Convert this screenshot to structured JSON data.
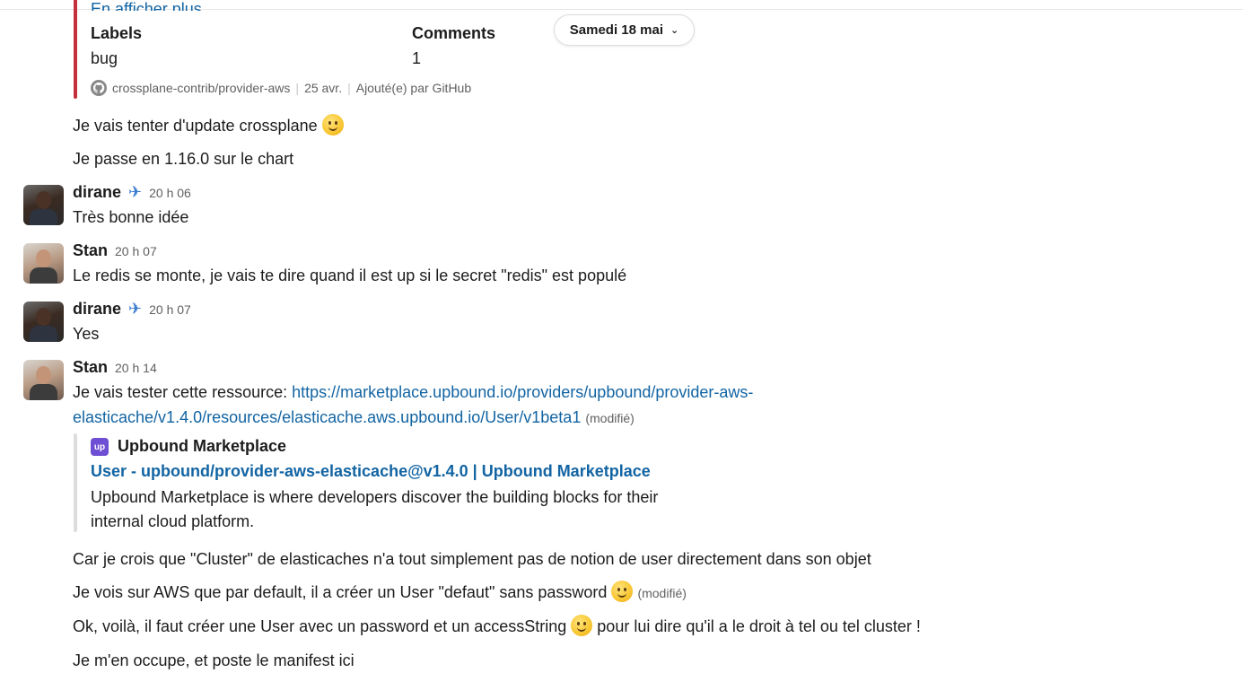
{
  "github_unfurl": {
    "more_link": "En afficher plus",
    "fields": [
      {
        "title": "Labels",
        "value": "bug"
      },
      {
        "title": "Comments",
        "value": "1"
      }
    ],
    "footer": {
      "repo": "crossplane-contrib/provider-aws",
      "date": "25 avr.",
      "added_by": "Ajouté(e) par GitHub"
    }
  },
  "date_divider": {
    "label": "Samedi 18 mai"
  },
  "pre_messages": [
    {
      "text": "Je vais tenter d'update crossplane"
    },
    {
      "text": "Je passe en 1.16.0 sur le chart"
    }
  ],
  "messages": [
    {
      "author": "dirane",
      "status_emoji": "✈️",
      "time": "20 h 06",
      "text": "Très bonne idée"
    },
    {
      "author": "Stan",
      "time": "20 h 07",
      "text": "Le redis se monte, je vais te dire quand il est up si le secret \"redis\" est populé"
    },
    {
      "author": "dirane",
      "status_emoji": "✈️",
      "time": "20 h 07",
      "text": "Yes"
    },
    {
      "author": "Stan",
      "time": "20 h 14",
      "text_prefix": "Je vais tester cette ressource: ",
      "link_line1": "https://marketplace.upbound.io/providers/upbound/provider-aws-",
      "link_line2": "elasticache/v1.4.0/resources/elasticache.aws.upbound.io/User/v1beta1",
      "edited": "(modifié)"
    }
  ],
  "upbound_unfurl": {
    "logo": "up",
    "site": "Upbound Marketplace",
    "title": "User - upbound/provider-aws-elasticache@v1.4.0 | Upbound Marketplace",
    "description": "Upbound Marketplace is where developers discover the building blocks for their internal cloud platform."
  },
  "followups": [
    {
      "text": "Car je crois que \"Cluster\" de elasticaches n'a tout simplement pas de notion de user directement dans son objet"
    },
    {
      "text": "Je vois sur AWS que par default, il a créer un User \"defaut\" sans password",
      "edited": "(modifié)"
    },
    {
      "text_a": "Ok, voilà, il faut créer une User avec un password et un accessString",
      "text_b": "pour lui dire qu'il a le droit à tel ou tel cluster !"
    },
    {
      "text": "Je m'en occupe, et poste le manifest ici"
    }
  ],
  "colors": {
    "link": "#1264a3",
    "github_bar": "#c3303a",
    "upbound_logo": "#6e4fd3"
  },
  "icons": [
    "github-icon",
    "airplane-icon",
    "slightly-smiling-face-icon",
    "chevron-down-icon",
    "upbound-logo-icon"
  ]
}
